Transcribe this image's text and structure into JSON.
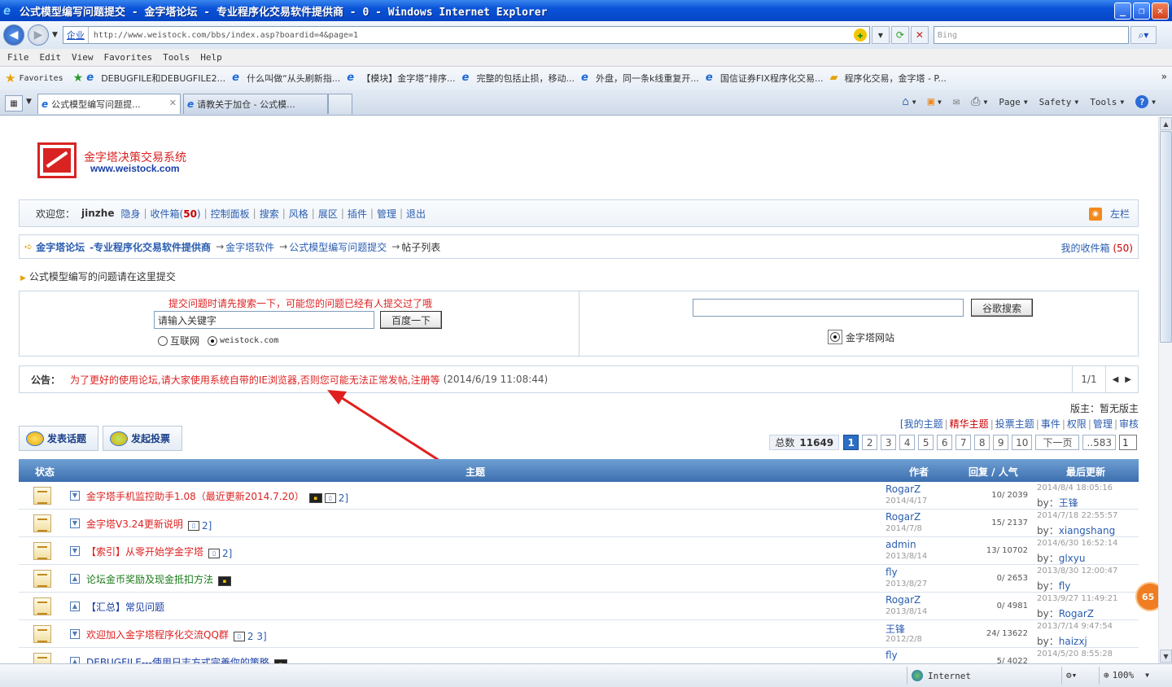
{
  "window": {
    "title": "公式模型编写问题提交 - 金字塔论坛 - 专业程序化交易软件提供商 - 0 - Windows Internet Explorer",
    "minimize": "_",
    "maximize": "❐",
    "close": "✕"
  },
  "address": {
    "zone": "企业",
    "url": "http://www.weistock.com/bbs/index.asp?boardid=4&page=1",
    "search_placeholder": "Bing"
  },
  "menu": [
    "File",
    "Edit",
    "View",
    "Favorites",
    "Tools",
    "Help"
  ],
  "favorites": {
    "label": "Favorites",
    "items": [
      "DEBUGFILE和DEBUGFILE2...",
      "什么叫做“从头刷新指...",
      "【模块】金字塔”排序...",
      "完整的包括止损，移动...",
      "外盘，同一条k线重复开...",
      "国信证券FIX程序化交易...",
      "程序化交易，金字塔 - P..."
    ],
    "more": "»"
  },
  "tabs": [
    {
      "label": "公式模型编写问题提..."
    },
    {
      "label": "请教关于加仓 - 公式模..."
    }
  ],
  "commands": {
    "page": "Page",
    "safety": "Safety",
    "tools": "Tools",
    "help": "?"
  },
  "site": {
    "logo_line1": "金字塔决策交易系统",
    "logo_line2": "www.weistock.com"
  },
  "userbar": {
    "welcome": "欢迎您：",
    "username": "jinzhe",
    "links": [
      {
        "label": "隐身"
      },
      {
        "label": "收件箱",
        "count": "50"
      },
      {
        "label": "控制面板"
      },
      {
        "label": "搜索"
      },
      {
        "label": "风格"
      },
      {
        "label": "展区"
      },
      {
        "label": "插件"
      },
      {
        "label": "管理"
      },
      {
        "label": "退出"
      }
    ],
    "sidebar": "左栏"
  },
  "breadcrumb": {
    "home": "金字塔论坛",
    "home_sub": "-专业程序化交易软件提供商",
    "level1": "金字塔软件",
    "level2": "公式模型编写问题提交",
    "current": "帖子列表",
    "inbox_label": "我的收件箱",
    "inbox_count": "(50)"
  },
  "forum_desc": "公式模型编写的问题请在这里提交",
  "search": {
    "tip": "提交问题时请先搜索一下，可能您的问题已经有人提交过了哦",
    "keyword": "请输入关键字",
    "baidu_button": "百度一下",
    "opt_internet": "互联网",
    "opt_site": "weistock.com",
    "google_button": "谷歌搜索",
    "google_site": "金字塔网站"
  },
  "announcement": {
    "label": "公告：",
    "message": "为了更好的使用论坛,请大家使用系统自带的IE浏览器,否则您可能无法正常发帖,注册等",
    "date": "(2014/6/19 11:08:44)",
    "pager": "1/1"
  },
  "moderator": "版主：暂无版主",
  "filters": [
    "我的主题",
    "精华主题",
    "投票主题",
    "事件",
    "权限",
    "管理",
    "审核"
  ],
  "actions": {
    "post_topic": "发表话题",
    "post_vote": "发起投票"
  },
  "pagination": {
    "total_label": "总数",
    "total": "11649",
    "pages": [
      "1",
      "2",
      "3",
      "4",
      "5",
      "6",
      "7",
      "8",
      "9",
      "10"
    ],
    "next": "下一页",
    "last": "..583",
    "input": "1"
  },
  "table": {
    "headers": {
      "status": "状态",
      "topic": "主题",
      "author": "作者",
      "replies": "回复 / 人气",
      "last": "最后更新"
    },
    "rows": [
      {
        "title": "金字塔手机监控助手1.08（最近更新2014.7.20）",
        "color": "red",
        "tags": "2]",
        "has_img": true,
        "author": "RogarZ",
        "adate": "2014/4/17",
        "stats": "10/ 2039",
        "ltime": "2014/8/4 18:05:16",
        "lby": "王锋"
      },
      {
        "title": "金字塔V3.24更新说明",
        "color": "red",
        "tags": "2]",
        "has_img": false,
        "author": "RogarZ",
        "adate": "2014/7/8",
        "stats": "15/ 2137",
        "ltime": "2014/7/18 22:55:57",
        "lby": "xiangshang"
      },
      {
        "title": "【索引】从零开始学金字塔",
        "color": "red",
        "tags": "2]",
        "has_img": false,
        "author": "admin",
        "adate": "2013/8/14",
        "stats": "13/ 10702",
        "ltime": "2014/6/30 16:52:14",
        "lby": "glxyu"
      },
      {
        "title": "论坛金币奖励及现金抵扣方法",
        "color": "green",
        "tags": "",
        "has_img": true,
        "author": "fly",
        "adate": "2013/8/27",
        "stats": "0/ 2653",
        "ltime": "2013/8/30 12:00:47",
        "lby": "fly"
      },
      {
        "title": "【汇总】常见问题",
        "color": "blue",
        "tags": "",
        "has_img": false,
        "author": "RogarZ",
        "adate": "2013/8/14",
        "stats": "0/ 4981",
        "ltime": "2013/9/27 11:49:21",
        "lby": "RogarZ"
      },
      {
        "title": "欢迎加入金字塔程序化交流QQ群",
        "color": "red",
        "tags": "2 3]",
        "has_img": false,
        "author": "王锋",
        "adate": "2012/2/8",
        "stats": "24/ 13622",
        "ltime": "2013/7/14 9:47:54",
        "lby": "haizxj"
      },
      {
        "title": "DEBUGFILE---使用日志方式完善你的策略",
        "color": "blue",
        "tags": "",
        "has_img": true,
        "author": "fly",
        "adate": "",
        "stats": "5/ 4022",
        "ltime": "2014/5/20 8:55:28",
        "lby": ""
      }
    ],
    "by": "by："
  },
  "float_badge": "65",
  "status": {
    "zone": "Internet",
    "zoom": "100%"
  },
  "colors": {
    "accent": "#2b6ec4",
    "link": "#2a5db0",
    "highlight": "#dd2222"
  }
}
